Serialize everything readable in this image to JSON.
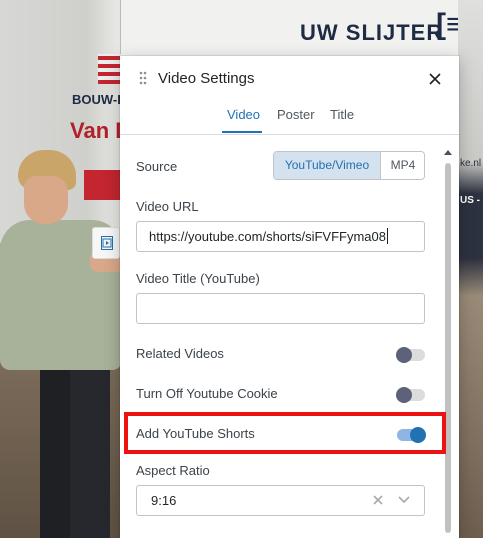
{
  "background_scene": {
    "sign_text": "UW SLIJTER",
    "sign_logo": "[≡",
    "bouw_text": "BOUW-EN T",
    "vandas_text": "Van Das",
    "right_text_1": "ke.nl",
    "right_text_2": "US -"
  },
  "dialog": {
    "title": "Video Settings",
    "close_icon": "close-icon",
    "drag_icon": "drag-handle-icon"
  },
  "tabs": [
    {
      "label": "Video",
      "active": true
    },
    {
      "label": "Poster",
      "active": false
    },
    {
      "label": "Title",
      "active": false
    }
  ],
  "source": {
    "label": "Source",
    "options": [
      "YouTube/Vimeo",
      "MP4"
    ],
    "selected": "YouTube/Vimeo"
  },
  "video_url": {
    "label": "Video URL",
    "value": "https://youtube.com/shorts/siFVFFyma08"
  },
  "video_title": {
    "label": "Video Title (YouTube)",
    "value": ""
  },
  "toggles": [
    {
      "label": "Related Videos",
      "on": false
    },
    {
      "label": "Turn Off Youtube Cookie",
      "on": false
    },
    {
      "label": "Add YouTube Shorts",
      "on": true
    }
  ],
  "aspect_ratio": {
    "label": "Aspect Ratio",
    "value": "9:16"
  },
  "colors": {
    "accent": "#2271b1",
    "highlight": "#ee1111",
    "toggle_off_knob": "#5c6279"
  }
}
